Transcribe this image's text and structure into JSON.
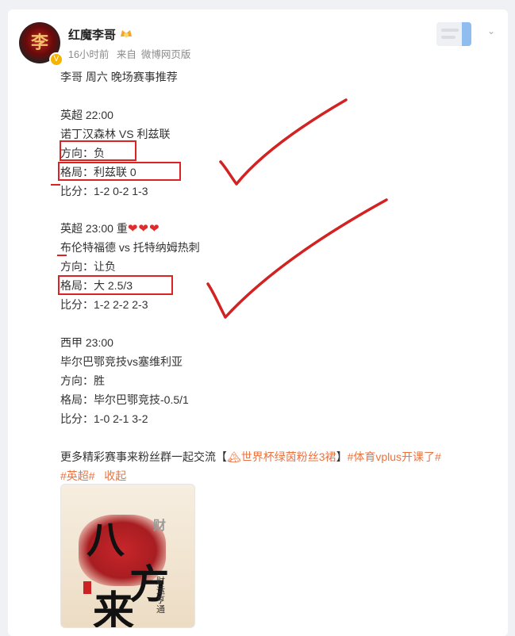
{
  "post": {
    "author": "红魔李哥",
    "time": "16小时前",
    "source_prefix": "来自",
    "source": "微博网页版",
    "avatar_text": "李"
  },
  "content": {
    "title": "李哥 周六 晚场赛事推荐",
    "matches": [
      {
        "league_time": "英超  22:00",
        "teams": "诺丁汉森林 VS 利兹联",
        "direction": "方向：负",
        "pattern": "格局：利兹联 0",
        "score": "比分：1-2 0-2 1-3"
      },
      {
        "league_time": "英超  23:00    重",
        "hearts": "❤❤❤",
        "teams": "布伦特福德 vs 托特纳姆热刺",
        "direction": "方向：让负",
        "pattern": "格局：大 2.5/3",
        "score": "比分：1-2 2-2 2-3"
      },
      {
        "league_time": "西甲 23:00",
        "teams": "毕尔巴鄂竞技vs塞维利亚",
        "direction": "方向：胜",
        "pattern": "格局：毕尔巴鄂竞技-0.5/1",
        "score": "比分：1-0 2-1 3-2"
      }
    ],
    "promo_text": "更多精彩赛事来粉丝群一起交流【",
    "group_link": "🏔世界杯绿茵粉丝3裙",
    "promo_close": "】",
    "tag1": "#体育vplus开课了#",
    "tag2": "#英超#",
    "collapse": "收起"
  },
  "image": {
    "calligraphy_1": "八",
    "calligraphy_2": "方",
    "calligraphy_3": "来",
    "calligraphy_small": "财",
    "signature": "财运亨通"
  },
  "colors": {
    "annotation_red": "#d22222",
    "link_orange": "#eb7340",
    "verified_gold": "#f5b400"
  }
}
